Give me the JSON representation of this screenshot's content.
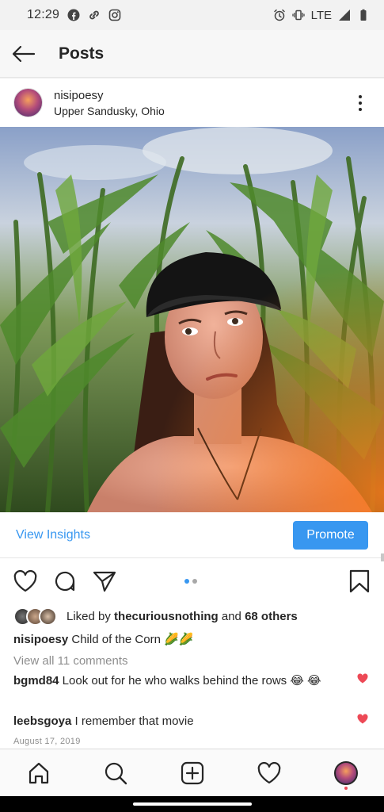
{
  "status_bar": {
    "time": "12:29",
    "network": "LTE"
  },
  "top_bar": {
    "title": "Posts"
  },
  "post": {
    "username": "nisipoesy",
    "location": "Upper Sandusky, Ohio",
    "insights_label": "View Insights",
    "promote_label": "Promote",
    "likes": {
      "prefix": "Liked by ",
      "user": "thecuriousnothing",
      "middle": " and ",
      "others": "68 others"
    },
    "caption": {
      "user": "nisipoesy",
      "text": " Child of the Corn 🌽🌽"
    },
    "view_comments": "View all 11 comments",
    "comments": [
      {
        "user": "bgmd84",
        "text": " Look out for he who walks behind the rows 😂 😂"
      },
      {
        "user": "leebsgoya",
        "text": " I remember that movie"
      }
    ],
    "date": "August 17, 2019"
  },
  "colors": {
    "accent": "#3897f0",
    "heart": "#ed4956"
  }
}
